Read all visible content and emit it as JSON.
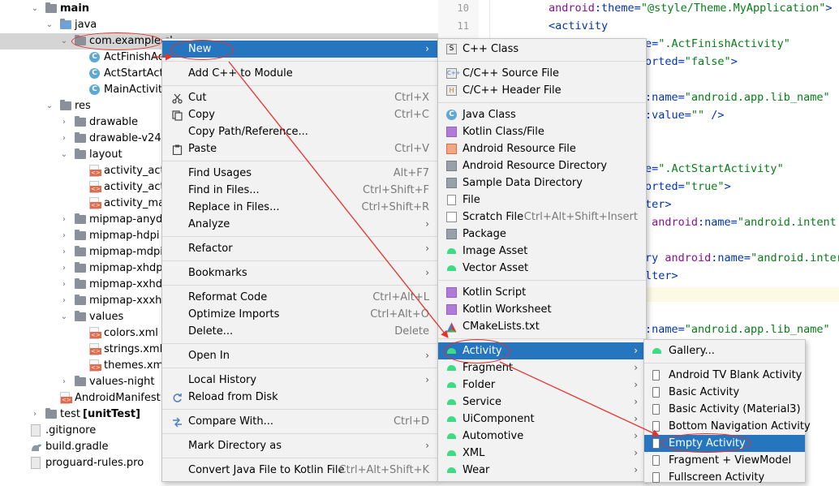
{
  "tree": {
    "main": "main",
    "java": "java",
    "package": "com.example.cl",
    "act_finish": "ActFinishActi",
    "act_start": "ActStartActiv",
    "main_activity": "MainActivity",
    "res": "res",
    "drawable": "drawable",
    "drawable_v24": "drawable-v24",
    "layout": "layout",
    "act_f": "activity_act_f",
    "act_s": "activity_act_s",
    "act_main": "activity_main",
    "mipmap_anydpi": "mipmap-anydp",
    "mipmap_hdpi": "mipmap-hdpi",
    "mipmap_mdpi": "mipmap-mdpi",
    "mipmap_xhdpi": "mipmap-xhdpi",
    "mipmap_xxhdpi": "mipmap-xxhdp",
    "mipmap_xxxhdpi": "mipmap-xxxhdp",
    "values": "values",
    "colors": "colors.xml",
    "strings": "strings.xml",
    "themes": "themes.xml",
    "values_night": "values-night",
    "manifest": "AndroidManifest.x",
    "test": "test",
    "unit_test": "[unitTest]",
    "gitignore": ".gitignore",
    "build_gradle": "build.gradle",
    "proguard": "proguard-rules.pro"
  },
  "editor": {
    "ln10": "10",
    "ln11": "11",
    "c1a": "android",
    "c1b": ":theme=",
    "c1c": "\"@style/Theme.MyApplication\"",
    "c1d": ">",
    "c2": "<activity",
    "c3a": "e=",
    "c3b": "\".ActFinishActivity\"",
    "c4a": "orted=",
    "c4b": "\"false\"",
    "c4c": ">",
    "c5a": ":name=",
    "c5b": "\"android.app.lib_name\"",
    "c6a": ":value=",
    "c6b": "\"\"",
    "c6c": " />",
    "c7a": "e=",
    "c7b": "\".ActStartActivity\"",
    "c8a": "orted=",
    "c8b": "\"true\"",
    "c8c": ">",
    "c9": "ter>",
    "c10a": "android",
    "c10b": ":name=",
    "c10c": "\"android.intent.",
    "c11a": "ry ",
    "c11b": "android",
    "c11c": ":name=",
    "c11d": "\"android.inter",
    "c12": "lter>",
    "c13a": ":name=",
    "c13b": "\"android.app.lib_name\""
  },
  "context_menu": {
    "new": "New",
    "add_cpp": "Add C++ to Module",
    "cut": "Cut",
    "cut_sc": "Ctrl+X",
    "copy": "Copy",
    "copy_sc": "Ctrl+C",
    "copy_path": "Copy Path/Reference...",
    "paste": "Paste",
    "paste_sc": "Ctrl+V",
    "find_usages": "Find Usages",
    "find_usages_sc": "Alt+F7",
    "find_in_files": "Find in Files...",
    "find_in_files_sc": "Ctrl+Shift+F",
    "replace_in_files": "Replace in Files...",
    "replace_in_files_sc": "Ctrl+Shift+R",
    "analyze": "Analyze",
    "refactor": "Refactor",
    "bookmarks": "Bookmarks",
    "reformat": "Reformat Code",
    "reformat_sc": "Ctrl+Alt+L",
    "optimize": "Optimize Imports",
    "optimize_sc": "Ctrl+Alt+O",
    "delete": "Delete...",
    "delete_sc": "Delete",
    "open_in": "Open In",
    "local_history": "Local History",
    "reload": "Reload from Disk",
    "compare": "Compare With...",
    "compare_sc": "Ctrl+D",
    "mark_dir": "Mark Directory as",
    "convert": "Convert Java File to Kotlin File",
    "convert_sc": "Ctrl+Alt+Shift+K"
  },
  "new_menu": {
    "cpp_class": "C++ Class",
    "cpp_source": "C/C++ Source File",
    "cpp_header": "C/C++ Header File",
    "java_class": "Java Class",
    "kotlin_class": "Kotlin Class/File",
    "android_res_file": "Android Resource File",
    "android_res_dir": "Android Resource Directory",
    "sample_data": "Sample Data Directory",
    "file": "File",
    "scratch": "Scratch File",
    "scratch_sc": "Ctrl+Alt+Shift+Insert",
    "package": "Package",
    "image_asset": "Image Asset",
    "vector_asset": "Vector Asset",
    "kotlin_script": "Kotlin Script",
    "kotlin_worksheet": "Kotlin Worksheet",
    "cmake": "CMakeLists.txt",
    "activity": "Activity",
    "fragment": "Fragment",
    "folder": "Folder",
    "service": "Service",
    "ui_component": "UiComponent",
    "automotive": "Automotive",
    "xml": "XML",
    "wear": "Wear"
  },
  "activity_menu": {
    "gallery": "Gallery...",
    "tv_blank": "Android TV Blank Activity",
    "basic": "Basic Activity",
    "basic_m3": "Basic Activity (Material3)",
    "bottom_nav": "Bottom Navigation Activity",
    "empty": "Empty Activity",
    "fragment_vm": "Fragment + ViewModel",
    "fullscreen": "Fullscreen Activity"
  },
  "colors": {
    "selection": "#2675bf",
    "annotation": "#e5322d",
    "android_green": "#3ddc84"
  }
}
